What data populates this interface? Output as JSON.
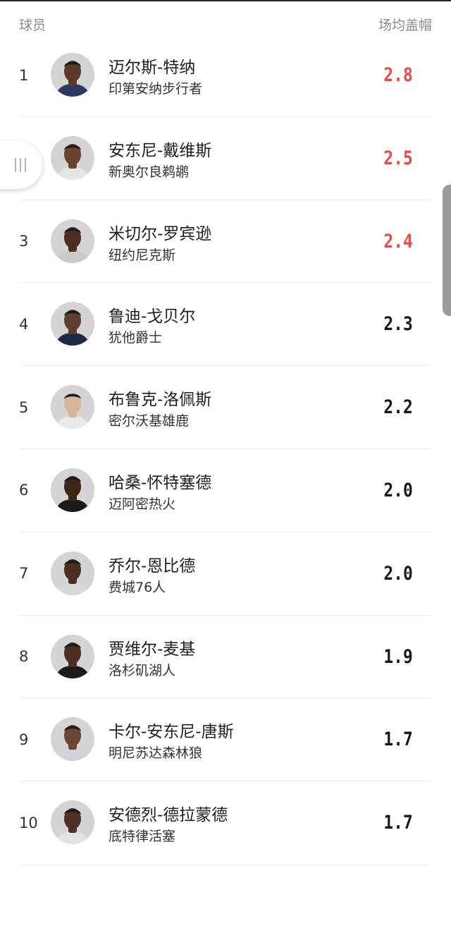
{
  "header": {
    "col_player": "球员",
    "col_stat": "场均盖帽"
  },
  "side_handle_icon": "drag-handle-icon",
  "players": [
    {
      "rank": "1",
      "name": "迈尔斯-特纳",
      "team": "印第安纳步行者",
      "value": "2.8",
      "highlight": true,
      "jersey": "#2b3a60",
      "skin": "#5b3a28"
    },
    {
      "rank": "2",
      "name": "安东尼-戴维斯",
      "team": "新奥尔良鹈鹕",
      "value": "2.5",
      "highlight": true,
      "jersey": "#e5e5e5",
      "skin": "#6a4230"
    },
    {
      "rank": "3",
      "name": "米切尔-罗宾逊",
      "team": "纽约尼克斯",
      "value": "2.4",
      "highlight": true,
      "jersey": "#c9c9c9",
      "skin": "#4a2e20"
    },
    {
      "rank": "4",
      "name": "鲁迪-戈贝尔",
      "team": "犹他爵士",
      "value": "2.3",
      "highlight": false,
      "jersey": "#1d2a44",
      "skin": "#5e3e2e"
    },
    {
      "rank": "5",
      "name": "布鲁克-洛佩斯",
      "team": "密尔沃基雄鹿",
      "value": "2.2",
      "highlight": false,
      "jersey": "#e9e9e9",
      "skin": "#d6b59a"
    },
    {
      "rank": "6",
      "name": "哈桑-怀特塞德",
      "team": "迈阿密热火",
      "value": "2.0",
      "highlight": false,
      "jersey": "#1a1a1a",
      "skin": "#3d2518"
    },
    {
      "rank": "7",
      "name": "乔尔-恩比德",
      "team": "费城76人",
      "value": "2.0",
      "highlight": false,
      "jersey": "#d8d8d8",
      "skin": "#4d2f22"
    },
    {
      "rank": "8",
      "name": "贾维尔-麦基",
      "team": "洛杉矶湖人",
      "value": "1.9",
      "highlight": false,
      "jersey": "#1c1c1c",
      "skin": "#4a2f22"
    },
    {
      "rank": "9",
      "name": "卡尔-安东尼-唐斯",
      "team": "明尼苏达森林狼",
      "value": "1.7",
      "highlight": false,
      "jersey": "#d0d4d8",
      "skin": "#6b4634"
    },
    {
      "rank": "10",
      "name": "安德烈-德拉蒙德",
      "team": "底特律活塞",
      "value": "1.7",
      "highlight": false,
      "jersey": "#e2e2e2",
      "skin": "#4e3024"
    }
  ]
}
